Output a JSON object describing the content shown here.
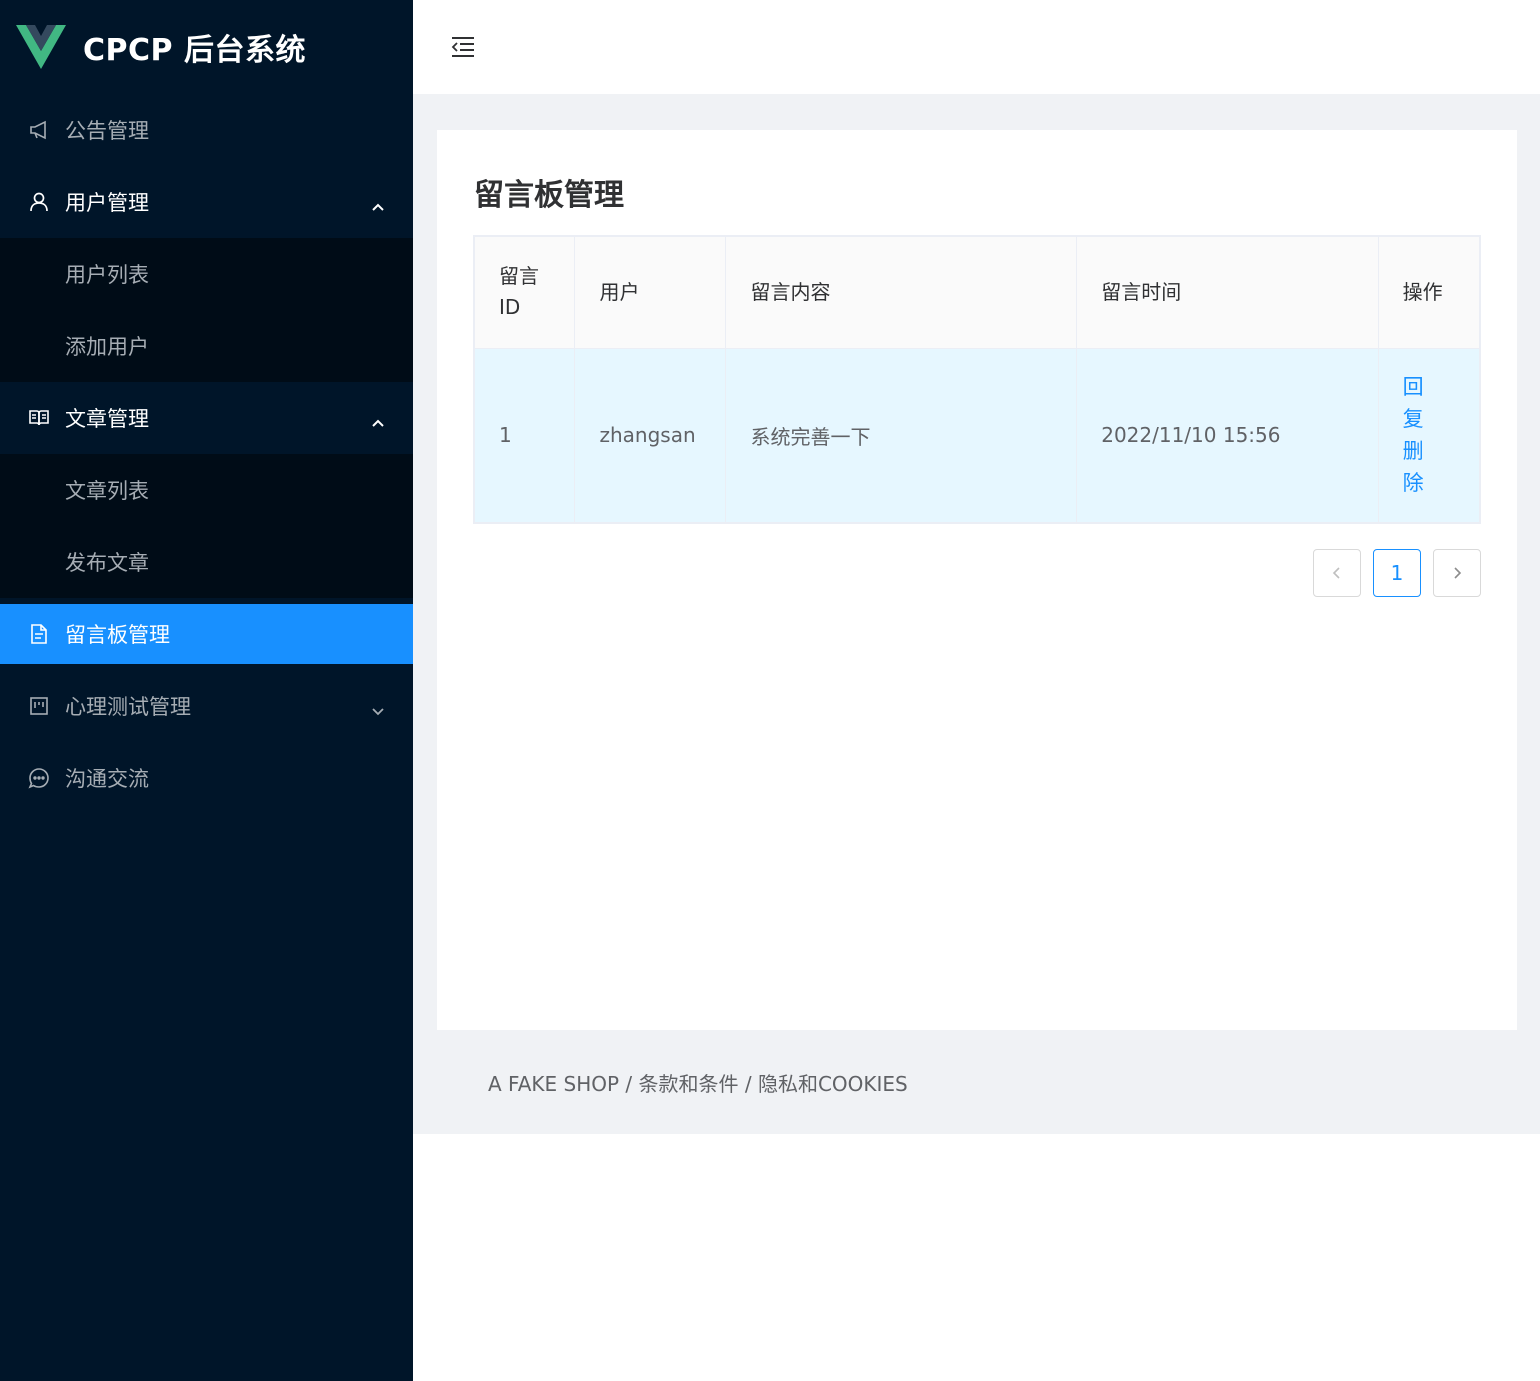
{
  "brand": {
    "title": "CPCP 后台系统",
    "logo_colors": [
      "#41b883",
      "#34495e"
    ]
  },
  "sidebar": {
    "items": [
      {
        "label": "公告管理",
        "icon": "megaphone-icon"
      },
      {
        "label": "用户管理",
        "icon": "user-icon",
        "expanded": true,
        "children": [
          {
            "label": "用户列表"
          },
          {
            "label": "添加用户"
          }
        ]
      },
      {
        "label": "文章管理",
        "icon": "book-icon",
        "expanded": true,
        "children": [
          {
            "label": "文章列表"
          },
          {
            "label": "发布文章"
          }
        ]
      },
      {
        "label": "留言板管理",
        "icon": "document-icon",
        "active": true
      },
      {
        "label": "心理测试管理",
        "icon": "board-icon",
        "expanded": false
      },
      {
        "label": "沟通交流",
        "icon": "chat-icon"
      }
    ]
  },
  "header": {
    "fold_icon": "menu-fold-icon"
  },
  "page": {
    "title": "留言板管理"
  },
  "table": {
    "columns": [
      "留言ID",
      "用户",
      "留言内容",
      "留言时间",
      "操作"
    ],
    "rows": [
      {
        "id": "1",
        "user": "zhangsan",
        "content": "系统完善一下",
        "time": "2022/11/10 15:56",
        "actions": [
          "回复",
          "删除"
        ]
      }
    ]
  },
  "pagination": {
    "current": "1"
  },
  "footer": {
    "text": "A FAKE SHOP / 条款和条件 / 隐私和COOKIES"
  },
  "colors": {
    "sidebar_bg": "#001529",
    "submenu_bg": "#000c17",
    "accent": "#1890ff",
    "row_highlight": "#e6f7ff",
    "content_bg": "#f0f2f5"
  }
}
